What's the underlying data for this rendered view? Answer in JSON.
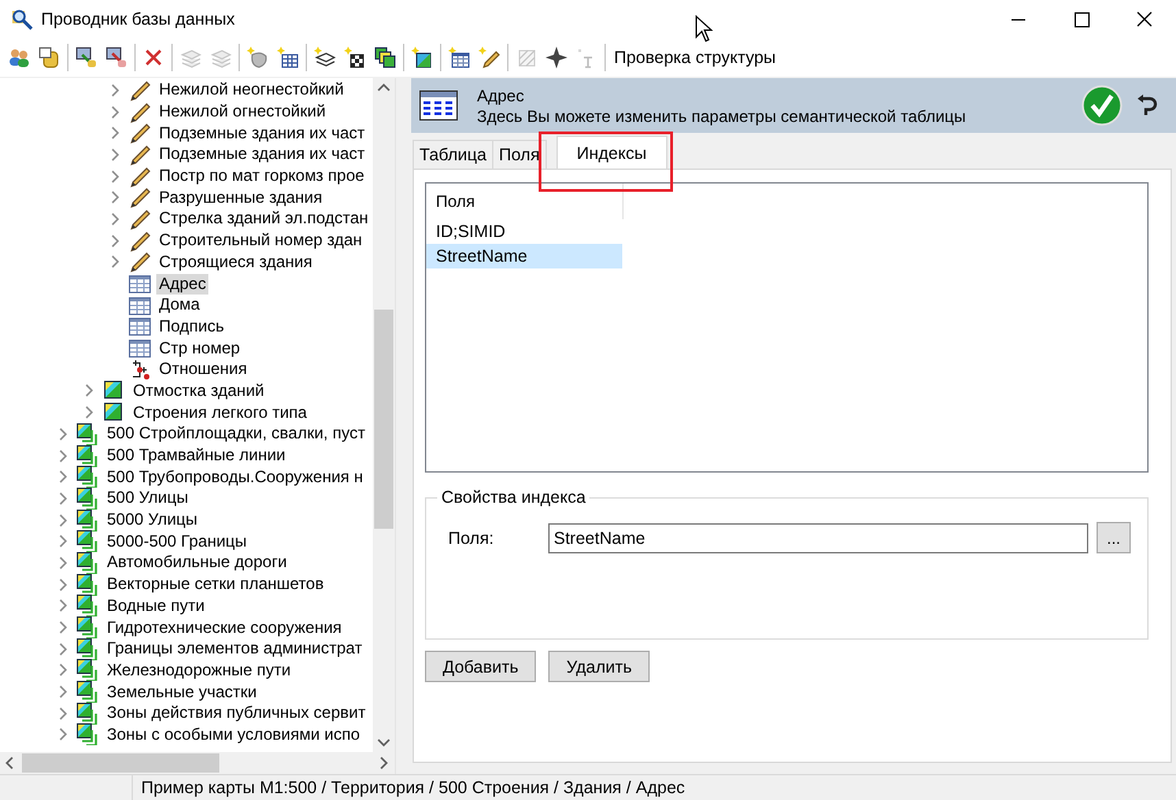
{
  "window": {
    "title": "Проводник базы данных"
  },
  "toolbar": {
    "buttons": [
      {
        "disabled": false,
        "separator_after": false
      },
      {
        "disabled": false,
        "separator_after": true
      },
      {
        "disabled": false,
        "separator_after": false
      },
      {
        "disabled": false,
        "separator_after": true
      },
      {
        "disabled": false,
        "separator_after": true
      },
      {
        "disabled": true,
        "separator_after": false
      },
      {
        "disabled": true,
        "separator_after": true
      },
      {
        "disabled": false,
        "separator_after": false
      },
      {
        "disabled": false,
        "separator_after": true
      },
      {
        "disabled": false,
        "separator_after": false
      },
      {
        "disabled": false,
        "separator_after": false
      },
      {
        "disabled": false,
        "separator_after": true
      },
      {
        "disabled": false,
        "separator_after": true
      },
      {
        "disabled": false,
        "separator_after": false
      },
      {
        "disabled": false,
        "separator_after": true
      },
      {
        "disabled": true,
        "separator_after": false
      },
      {
        "disabled": false,
        "separator_after": false
      },
      {
        "disabled": true,
        "separator_after": true
      }
    ],
    "label_button": "Проверка структуры"
  },
  "tree": {
    "items": [
      {
        "children": [
          {
            "children": [
              {
                "label": "Нежилой неогнестойкий",
                "kind": "pencil",
                "expandable": true,
                "selected": false
              },
              {
                "label": "Нежилой огнестойкий",
                "kind": "pencil",
                "expandable": true,
                "selected": false
              },
              {
                "label": "Подземные здания их част",
                "kind": "pencil",
                "expandable": true,
                "selected": false
              },
              {
                "label": "Подземные здания их част",
                "kind": "pencil",
                "expandable": true,
                "selected": false
              },
              {
                "label": "Постр по мат горкомз прое",
                "kind": "pencil",
                "expandable": true,
                "selected": false
              },
              {
                "label": "Разрушенные здания",
                "kind": "pencil",
                "expandable": true,
                "selected": false
              },
              {
                "label": "Стрелка зданий эл.подстан",
                "kind": "pencil",
                "expandable": true,
                "selected": false
              },
              {
                "label": "Строительный номер здан",
                "kind": "pencil",
                "expandable": true,
                "selected": false
              },
              {
                "label": "Строящиеся здания",
                "kind": "pencil",
                "expandable": true,
                "selected": false
              },
              {
                "label": "Адрес",
                "kind": "table",
                "expandable": false,
                "selected": true
              },
              {
                "label": "Дома",
                "kind": "table",
                "expandable": false,
                "selected": false
              },
              {
                "label": "Подпись",
                "kind": "table",
                "expandable": false,
                "selected": false
              },
              {
                "label": "Стр номер",
                "kind": "table",
                "expandable": false,
                "selected": false
              },
              {
                "label": "Отношения",
                "kind": "relations",
                "expandable": false,
                "selected": false
              }
            ]
          },
          {
            "label": "Отмостка зданий",
            "kind": "layer",
            "expandable": true,
            "selected": false
          },
          {
            "label": "Строения легкого типа",
            "kind": "layer",
            "expandable": true,
            "selected": false
          }
        ]
      },
      {
        "label": "500 Стройплощадки, свалки, пуст",
        "kind": "layers",
        "expandable": true,
        "selected": false
      },
      {
        "label": "500 Трамвайные линии",
        "kind": "layers",
        "expandable": true,
        "selected": false
      },
      {
        "label": "500 Трубопроводы.Сооружения н",
        "kind": "layers",
        "expandable": true,
        "selected": false
      },
      {
        "label": "500 Улицы",
        "kind": "layers",
        "expandable": true,
        "selected": false
      },
      {
        "label": "5000 Улицы",
        "kind": "layers",
        "expandable": true,
        "selected": false
      },
      {
        "label": "5000-500 Границы",
        "kind": "layers",
        "expandable": true,
        "selected": false
      },
      {
        "label": "Автомобильные дороги",
        "kind": "layers",
        "expandable": true,
        "selected": false
      },
      {
        "label": "Векторные сетки планшетов",
        "kind": "layers",
        "expandable": true,
        "selected": false
      },
      {
        "label": "Водные пути",
        "kind": "layers",
        "expandable": true,
        "selected": false
      },
      {
        "label": "Гидротехнические сооружения",
        "kind": "layers",
        "expandable": true,
        "selected": false
      },
      {
        "label": "Границы элементов администрат",
        "kind": "layers",
        "expandable": true,
        "selected": false
      },
      {
        "label": "Железнодорожные пути",
        "kind": "layers",
        "expandable": true,
        "selected": false
      },
      {
        "label": "Земельные участки",
        "kind": "layers",
        "expandable": true,
        "selected": false
      },
      {
        "label": "Зоны действия публичных сервит",
        "kind": "layers",
        "expandable": true,
        "selected": false
      },
      {
        "label": "Зоны с особыми условиями испо",
        "kind": "layers",
        "expandable": true,
        "selected": false
      }
    ]
  },
  "header": {
    "title": "Адрес",
    "subtitle": "Здесь Вы можете изменить параметры семантической таблицы"
  },
  "tabs": [
    {
      "label": "Таблица",
      "selected": false
    },
    {
      "label": "Поля",
      "selected": false
    },
    {
      "label": "Индексы",
      "selected": true
    }
  ],
  "index_list": {
    "column": "Поля",
    "rows": [
      {
        "label": "ID;SIMID",
        "selected": false
      },
      {
        "label": "StreetName",
        "selected": true
      }
    ]
  },
  "index_properties": {
    "title": "Свойства индекса",
    "field_label": "Поля:",
    "field_value": "StreetName",
    "browse_button": "..."
  },
  "buttons": [
    "Добавить",
    "Удалить"
  ],
  "status_bar": "Пример карты М1:500 / Территория / 500 Строения / Здания / Адрес"
}
